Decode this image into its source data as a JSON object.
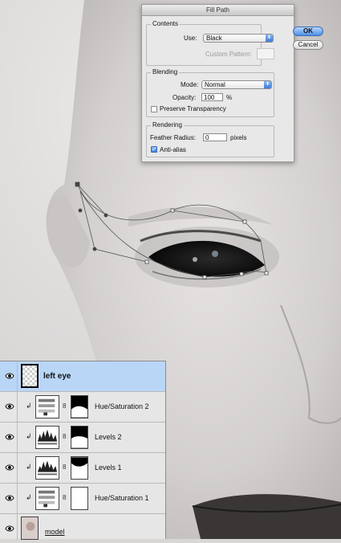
{
  "dialog": {
    "title": "Fill Path",
    "contents_label": "Contents",
    "use_label": "Use:",
    "use_value": "Black",
    "custom_pattern_label": "Custom Pattern:",
    "blending_label": "Blending",
    "mode_label": "Mode:",
    "mode_value": "Normal",
    "opacity_label": "Opacity:",
    "opacity_value": "100",
    "opacity_unit": "%",
    "preserve_transparency_label": "Preserve Transparency",
    "preserve_transparency_checked": false,
    "rendering_label": "Rendering",
    "feather_radius_label": "Feather Radius:",
    "feather_radius_value": "0",
    "feather_unit": "pixels",
    "anti_alias_label": "Anti-alias",
    "anti_alias_checked": true,
    "ok_label": "OK",
    "cancel_label": "Cancel",
    "arrows_glyph": "⬍",
    "check_glyph": "✓"
  },
  "layers": [
    {
      "name": "left eye",
      "type": "raster",
      "selected": true
    },
    {
      "name": "Hue/Saturation 2",
      "type": "hue-saturation",
      "clipped": true
    },
    {
      "name": "Levels 2",
      "type": "levels",
      "clipped": true
    },
    {
      "name": "Levels 1",
      "type": "levels",
      "clipped": true
    },
    {
      "name": "Hue/Saturation 1",
      "type": "hue-saturation",
      "clipped": true
    },
    {
      "name": "model",
      "type": "raster"
    }
  ],
  "icons": {
    "clip_arrow": "↲",
    "chain": "8"
  },
  "colors": {
    "selected_layer": "#b9d6f7",
    "accent_blue": "#4f8fe6",
    "path_color": "#555555"
  }
}
